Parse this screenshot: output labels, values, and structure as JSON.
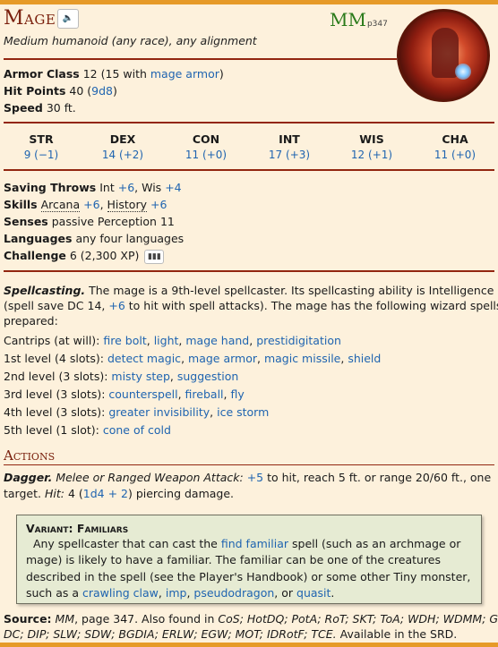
{
  "header": {
    "name": "Mage",
    "sound_icon": "speaker-icon",
    "source_abbr": "MM",
    "source_page": "p347",
    "subtitle": "Medium humanoid (any race), any alignment"
  },
  "defense": {
    "ac_label": "Armor Class",
    "ac_value": "12 (15 with",
    "ac_link": "mage armor",
    "ac_close": ")",
    "hp_label": "Hit Points",
    "hp_value": "40 (",
    "hp_link": "9d8",
    "hp_close": ")",
    "speed_label": "Speed",
    "speed_value": "30 ft."
  },
  "abilities": [
    {
      "name": "STR",
      "score": "9 (−1)"
    },
    {
      "name": "DEX",
      "score": "14 (+2)"
    },
    {
      "name": "CON",
      "score": "11 (+0)"
    },
    {
      "name": "INT",
      "score": "17 (+3)"
    },
    {
      "name": "WIS",
      "score": "12 (+1)"
    },
    {
      "name": "CHA",
      "score": "11 (+0)"
    }
  ],
  "traits": {
    "saves_label": "Saving Throws",
    "saves_int": "Int",
    "saves_int_bonus": "+6",
    "saves_wis": ", Wis",
    "saves_wis_bonus": "+4",
    "skills_label": "Skills",
    "skill1": "Arcana",
    "skill1_bonus": "+6",
    "skill2": "History",
    "skill2_bonus": "+6",
    "senses_label": "Senses",
    "senses_value": "passive Perception 11",
    "languages_label": "Languages",
    "languages_value": "any four languages",
    "challenge_label": "Challenge",
    "challenge_value": "6 (2,300 XP)",
    "challenge_icon": "bar-chart-icon"
  },
  "spellcasting": {
    "name": "Spellcasting.",
    "line1": "The mage is a 9th-level spellcaster. Its spellcasting ability is Intelligence",
    "line2a": "(spell save DC 14,",
    "line2_bonus": "+6",
    "line2b": "to hit with spell attacks). The mage has the following wizard spells",
    "line3": "prepared:",
    "cantrips_label": "Cantrips (at will):",
    "cantrips": [
      "fire bolt",
      "light",
      "mage hand",
      "prestidigitation"
    ],
    "l1_label": "1st level (4 slots):",
    "l1": [
      "detect magic",
      "mage armor",
      "magic missile",
      "shield"
    ],
    "l2_label": "2nd level (3 slots):",
    "l2": [
      "misty step",
      "suggestion"
    ],
    "l3_label": "3rd level (3 slots):",
    "l3": [
      "counterspell",
      "fireball",
      "fly"
    ],
    "l4_label": "4th level (3 slots):",
    "l4": [
      "greater invisibility",
      "ice storm"
    ],
    "l5_label": "5th level (1 slot):",
    "l5": [
      "cone of cold"
    ]
  },
  "actions": {
    "heading": "Actions",
    "dagger_name": "Dagger.",
    "dagger_type": "Melee or Ranged Weapon Attack:",
    "dagger_bonus": "+5",
    "dagger_text1": "to hit, reach 5 ft. or range 20/60 ft., one",
    "dagger_text2": "target.",
    "dagger_hit_label": "Hit:",
    "dagger_hit_value": "4 (",
    "dagger_dice": "1d4 + 2",
    "dagger_hit_close": ") piercing damage."
  },
  "variant": {
    "title": "Variant: Familiars",
    "l1a": "Any spellcaster that can cast the",
    "l1_link": "find familiar",
    "l1b": "spell (such as an archmage or",
    "l2": "mage) is likely to have a familiar. The familiar can be one of the creatures",
    "l3": "described in the spell (see the Player's Handbook) or some other Tiny monster,",
    "l4a": "such as a",
    "links": [
      "crawling claw",
      "imp",
      "pseudodragon",
      "quasit"
    ]
  },
  "source": {
    "label": "Source:",
    "book": "MM",
    "page_text": ", page 347. Also found in",
    "also1": "CoS; HotDQ; PotA; RoT; SKT; ToA; WDH; WDMM; GoS;",
    "also2": "DC; DIP; SLW; SDW; BGDIA; ERLW; EGW; MOT; IDRotF; TCE.",
    "srd": "Available in the SRD."
  },
  "colors": {
    "accent_rule": "#922610",
    "title": "#7a200d",
    "link": "#1f64b0",
    "source_badge": "#2a7a1a",
    "background": "#fdf1dc",
    "frame": "#e69a28",
    "variant_bg": "#e6ebd3"
  }
}
